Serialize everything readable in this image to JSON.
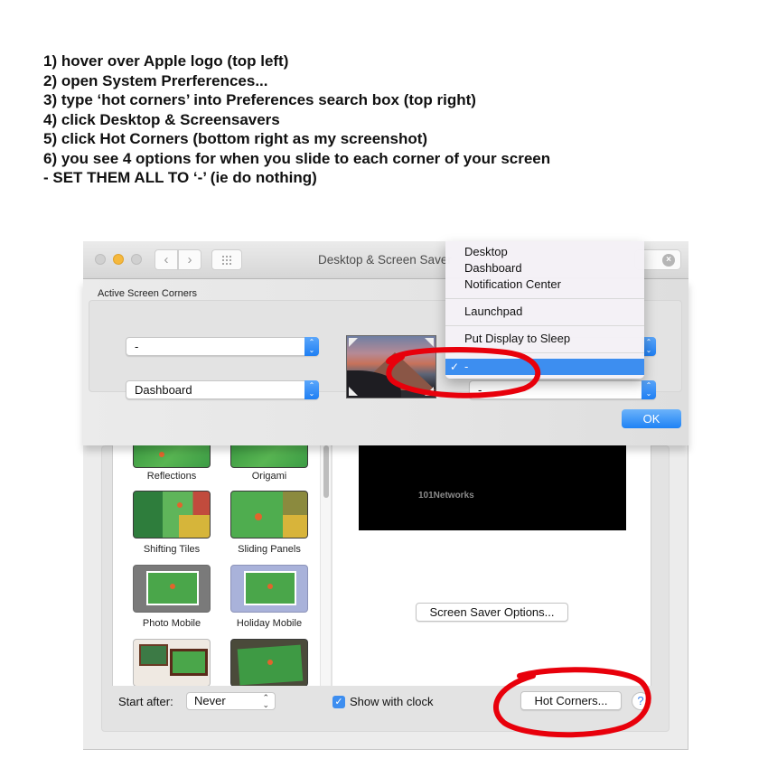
{
  "instructions": [
    "1) hover over Apple logo (top left)",
    "2) open System Prerferences...",
    "3) type ‘hot corners’ into Preferences search box (top right)",
    "4) click Desktop & Screensavers",
    "5) click Hot Corners (bottom right as my screenshot)",
    "6) you see 4 options for when you slide to each corner of your screen",
    "- SET THEM ALL TO ‘-’ (ie do nothing)"
  ],
  "window": {
    "title": "Desktop & Screen Saver",
    "nav_back_icon": "‹",
    "nav_forward_icon": "›",
    "search_clear_icon": "×"
  },
  "sheet": {
    "label": "Active Screen Corners",
    "corners": {
      "top_left": "-",
      "bottom_left": "Dashboard",
      "top_right": "",
      "bottom_right": "-"
    },
    "stepper_icon": "⌃⌄",
    "ok_label": "OK"
  },
  "menu": {
    "items": [
      {
        "label": "Desktop"
      },
      {
        "label": "Dashboard"
      },
      {
        "label": "Notification Center"
      },
      {
        "label": "Launchpad"
      },
      {
        "label": "Put Display to Sleep"
      },
      {
        "label": "-",
        "selected": true
      }
    ],
    "check_icon": "✓"
  },
  "screen_savers": [
    {
      "label": "Reflections"
    },
    {
      "label": "Origami"
    },
    {
      "label": "Shifting Tiles"
    },
    {
      "label": "Sliding Panels"
    },
    {
      "label": "Photo Mobile"
    },
    {
      "label": "Holiday Mobile"
    },
    {
      "label": ""
    },
    {
      "label": ""
    }
  ],
  "preview": {
    "text": "101Networks",
    "options_button": "Screen Saver Options..."
  },
  "bottom": {
    "start_after_label": "Start after:",
    "start_after_value": "Never",
    "show_clock_label": "Show with clock",
    "show_clock_checked": true,
    "check_icon": "✓",
    "hot_corners_label": "Hot Corners...",
    "help_label": "?"
  },
  "colors": {
    "accent": "#3d8ef0",
    "annotation": "#e8000b"
  }
}
